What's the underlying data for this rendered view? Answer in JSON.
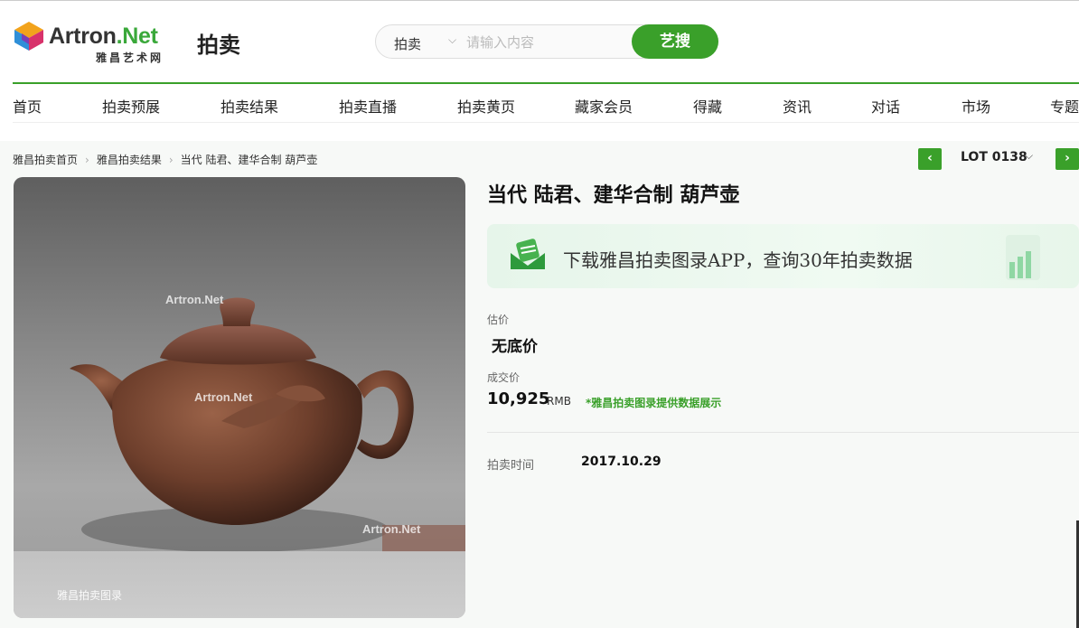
{
  "header": {
    "logo_text": "Artron",
    "logo_net": ".Net",
    "logo_sub": "雅昌艺术网",
    "section_title": "拍卖",
    "search": {
      "category": "拍卖",
      "placeholder": "请输入内容",
      "button": "艺搜"
    }
  },
  "nav": [
    "首页",
    "拍卖预展",
    "拍卖结果",
    "拍卖直播",
    "拍卖黄页",
    "藏家会员",
    "得藏",
    "资讯",
    "对话",
    "市场",
    "专题"
  ],
  "breadcrumb": [
    "雅昌拍卖首页",
    "雅昌拍卖结果",
    "当代 陆君、建华合制 葫芦壶"
  ],
  "lot": {
    "label": "LOT 0138",
    "prev": "‹",
    "next": "›"
  },
  "photo": {
    "watermark": "Artron.Net",
    "bottom_watermark": "雅昌拍卖图录"
  },
  "item": {
    "title": "当代 陆君、建华合制 葫芦壶",
    "banner_text": "下载雅昌拍卖图录APP，查询30年拍卖数据",
    "estimate_label": "估价",
    "estimate_value": "无底价",
    "deal_label": "成交价",
    "deal_value": "10,925",
    "deal_currency": "RMB",
    "deal_note": "*雅昌拍卖图录提供数据展示",
    "auction_time_label": "拍卖时间",
    "auction_time_value": "2017.10.29"
  },
  "colors": {
    "accent": "#3aa02a",
    "accent_light": "#e6f5ea"
  }
}
